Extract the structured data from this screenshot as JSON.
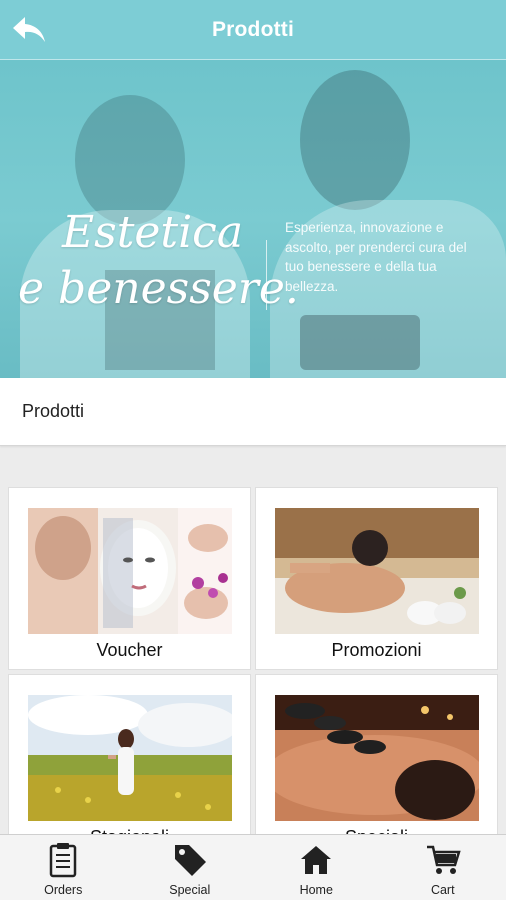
{
  "header": {
    "title": "Prodotti",
    "back_icon": "back-arrow-icon"
  },
  "banner": {
    "headline_line1": "Estetica",
    "headline_line2": "e benessere.",
    "tagline": "Esperienza, innovazione e ascolto, per prenderci cura del tuo benessere e della tua bellezza."
  },
  "section": {
    "title": "Prodotti"
  },
  "categories": [
    {
      "label": "Voucher"
    },
    {
      "label": "Promozioni"
    },
    {
      "label": "Stagionali"
    },
    {
      "label": "Speciali"
    }
  ],
  "tabbar": [
    {
      "label": "Orders",
      "icon": "clipboard-icon"
    },
    {
      "label": "Special",
      "icon": "tag-icon"
    },
    {
      "label": "Home",
      "icon": "home-icon"
    },
    {
      "label": "Cart",
      "icon": "cart-icon"
    }
  ],
  "colors": {
    "primary": "#7dcdd5",
    "text": "#222222",
    "background": "#ececec"
  }
}
